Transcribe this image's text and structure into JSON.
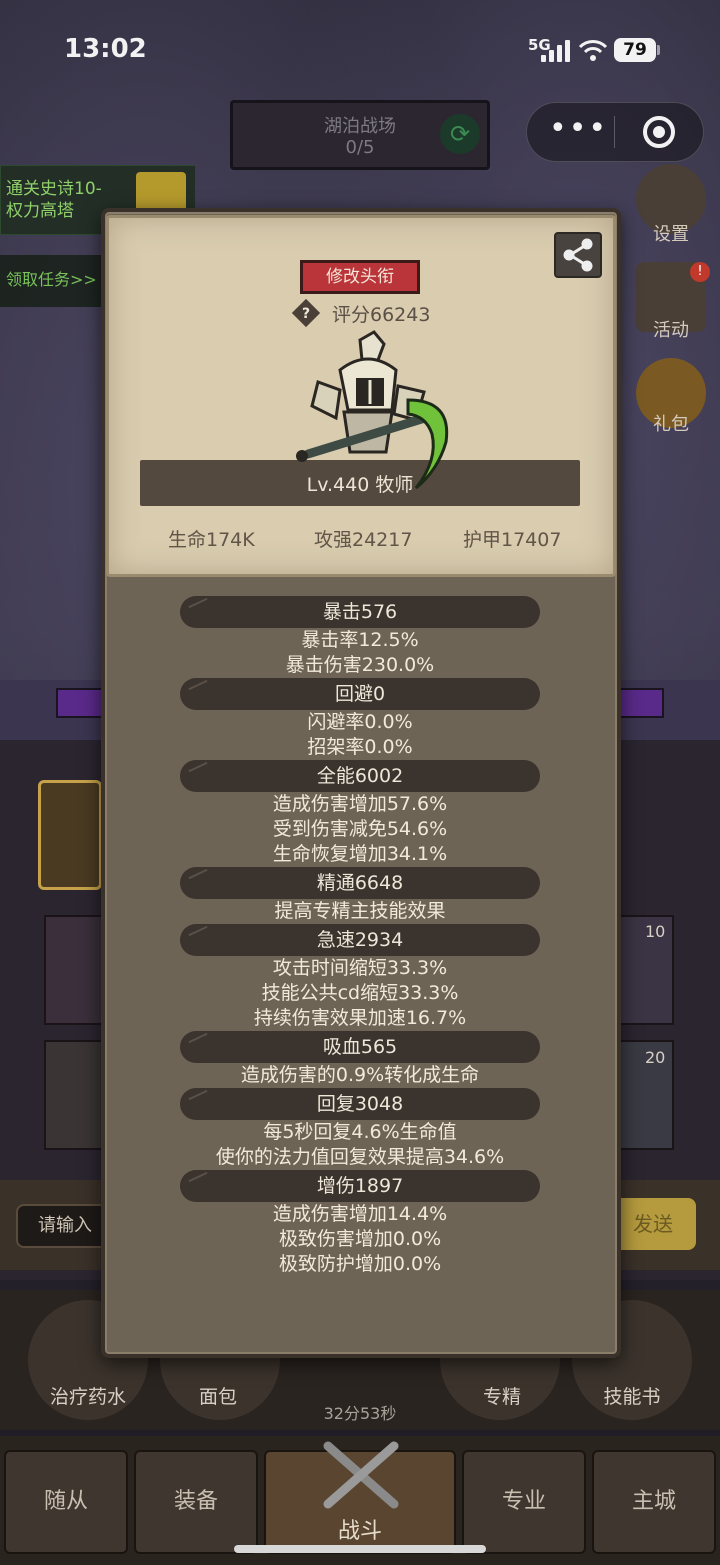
{
  "status_bar": {
    "time": "13:02",
    "network": "5G",
    "battery": "79"
  },
  "background": {
    "battlefield": {
      "title": "湖泊战场",
      "progress": "0/5"
    },
    "quest": {
      "text": "通关史诗10-权力高塔",
      "claim": "领取任务>>"
    },
    "side_buttons": [
      {
        "label": "设置"
      },
      {
        "label": "活动"
      },
      {
        "label": "礼包"
      }
    ],
    "chat_input_placeholder": "请输入",
    "send_label": "发送",
    "items": [
      {
        "label": "治疗药水"
      },
      {
        "label": "面包"
      },
      {
        "label": "专精"
      },
      {
        "label": "技能书"
      }
    ],
    "timer": "32分53秒",
    "slot_badges": [
      "10",
      "20"
    ],
    "nav_tabs": [
      {
        "label": "随从"
      },
      {
        "label": "装备"
      },
      {
        "label": "战斗"
      },
      {
        "label": "专业"
      },
      {
        "label": "主城"
      }
    ]
  },
  "profile": {
    "change_title_label": "修改头衔",
    "score": "评分66243",
    "level_class": "Lv.440 牧师",
    "stats": {
      "hp": "生命174K",
      "attack": "攻强24217",
      "armor": "护甲17407"
    }
  },
  "sections": [
    {
      "title": "暴击576",
      "lines": [
        "暴击率12.5%",
        "暴击伤害230.0%"
      ]
    },
    {
      "title": "回避0",
      "lines": [
        "闪避率0.0%",
        "招架率0.0%"
      ]
    },
    {
      "title": "全能6002",
      "lines": [
        "造成伤害增加57.6%",
        "受到伤害减免54.6%",
        "生命恢复增加34.1%"
      ]
    },
    {
      "title": "精通6648",
      "lines": [
        "提高专精主技能效果"
      ]
    },
    {
      "title": "急速2934",
      "lines": [
        "攻击时间缩短33.3%",
        "技能公共cd缩短33.3%",
        "持续伤害效果加速16.7%"
      ]
    },
    {
      "title": "吸血565",
      "lines": [
        "造成伤害的0.9%转化成生命"
      ]
    },
    {
      "title": "回复3048",
      "lines": [
        "每5秒回复4.6%生命值",
        "使你的法力值回复效果提高34.6%"
      ]
    },
    {
      "title": "增伤1897",
      "lines": [
        "造成伤害增加14.4%",
        "极致伤害增加0.0%",
        "极致防护增加0.0%"
      ]
    }
  ]
}
